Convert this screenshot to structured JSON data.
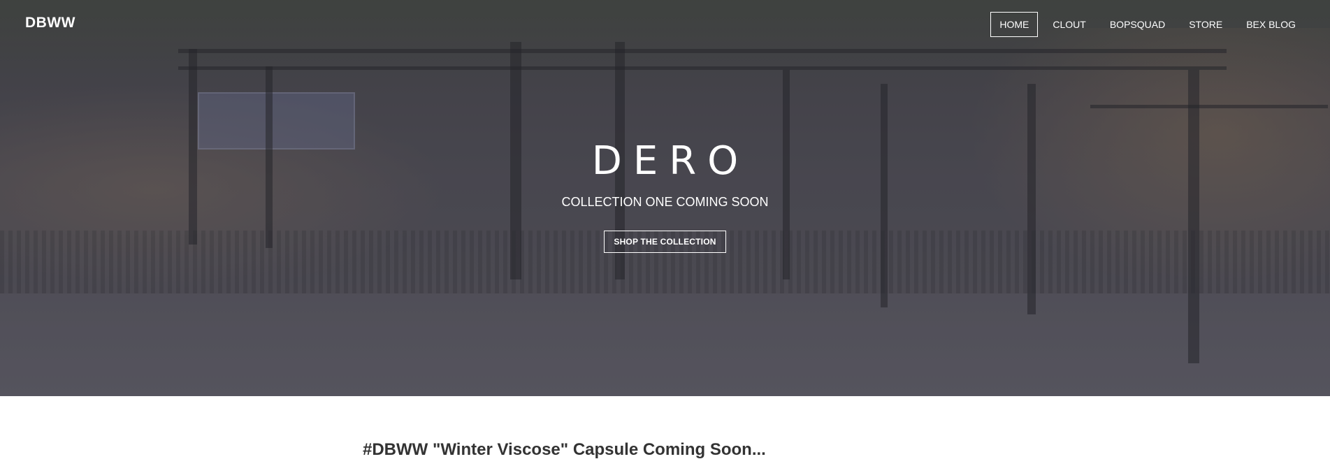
{
  "navbar": {
    "brand": "DBWW",
    "items": [
      {
        "label": "HOME",
        "active": true
      },
      {
        "label": "CLOUT",
        "active": false
      },
      {
        "label": "BOPSQUAD",
        "active": false
      },
      {
        "label": "STORE",
        "active": false
      },
      {
        "label": "BEX BLOG",
        "active": false
      }
    ]
  },
  "hero": {
    "title": "DERO",
    "subtitle": "COLLECTION ONE COMING SOON",
    "button_label": "SHOP THE COLLECTION",
    "background": "street-photo-image"
  },
  "content": {
    "post_title": "#DBWW \"Winter Viscose\" Capsule Coming Soon..."
  },
  "colors": {
    "hero_overlay": "#4a4850",
    "text_light": "#ffffff",
    "text_dark": "#333333"
  }
}
